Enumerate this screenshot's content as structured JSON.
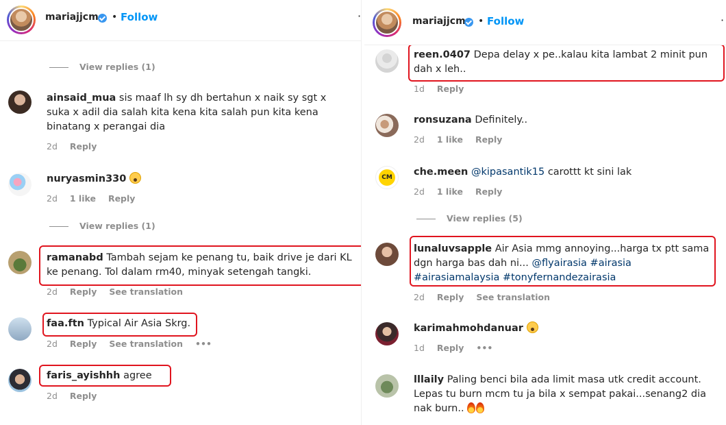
{
  "left": {
    "header": {
      "username": "mariajjcm",
      "dot": "•",
      "follow": "Follow",
      "more": "·"
    },
    "view_replies_1": "View replies (1)",
    "view_replies_2": "View replies (1)",
    "comments": [
      {
        "user": "ainsaid_mua",
        "text": "sis maaf lh sy dh bertahun x naik sy sgt x suka x adil dia salah kita kena kita salah pun kita kena binatang x perangai dia",
        "time": "2d",
        "reply": "Reply"
      },
      {
        "user": "nuryasmin330",
        "text": "",
        "emoji": "astonished-emoji",
        "time": "2d",
        "likes": "1 like",
        "reply": "Reply"
      },
      {
        "user": "ramanabd",
        "text": "Tambah sejam ke penang tu, baik drive je dari KL ke penang. Tol dalam rm40, minyak setengah tangki.",
        "time": "2d",
        "reply": "Reply",
        "translate": "See translation"
      },
      {
        "user": "faa.ftn",
        "text": "Typical Air Asia Skrg.",
        "time": "2d",
        "reply": "Reply",
        "translate": "See translation",
        "more": "•••"
      },
      {
        "user": "faris_ayishhh",
        "text": "agree",
        "time": "2d",
        "reply": "Reply"
      }
    ]
  },
  "right": {
    "header": {
      "username": "mariajjcm",
      "dot": "•",
      "follow": "Follow",
      "more": "·"
    },
    "view_replies": "View replies (5)",
    "comments": [
      {
        "user": "reen.0407",
        "text": "Depa delay x pe..kalau kita lambat 2 minit pun dah x leh..",
        "time": "1d",
        "reply": "Reply"
      },
      {
        "user": "ronsuzana",
        "text": "Definitely..",
        "time": "2d",
        "likes": "1 like",
        "reply": "Reply"
      },
      {
        "user": "che.meen",
        "mention": "@kipasantik15",
        "text": "carottt kt sini lak",
        "time": "2d",
        "likes": "1 like",
        "reply": "Reply",
        "avatar_label": "CM"
      },
      {
        "user": "lunaluvsapple",
        "text": "Air Asia mmg annoying...harga tx ptt sama dgn harga bas dah ni...",
        "tags": "@flyairasia #airasia #airasiamalaysia",
        "tags2": "#tonyfernandezairasia",
        "time": "2d",
        "reply": "Reply",
        "translate": "See translation"
      },
      {
        "user": "karimahmohdanuar",
        "text": "",
        "emoji": "astonished-emoji",
        "time": "1d",
        "reply": "Reply",
        "more": "•••"
      },
      {
        "user": "lllaily",
        "text": "Paling benci bila ada limit masa utk credit account. Lepas tu burn mcm tu ja bila x sempat pakai...senang2 dia nak burn..",
        "emoji": "fire-emoji",
        "time": "",
        "reply": ""
      }
    ]
  },
  "colors": {
    "follow": "#0095f6",
    "meta": "#8e8e8e",
    "highlight": "#e0141e",
    "mention": "#00376b"
  }
}
